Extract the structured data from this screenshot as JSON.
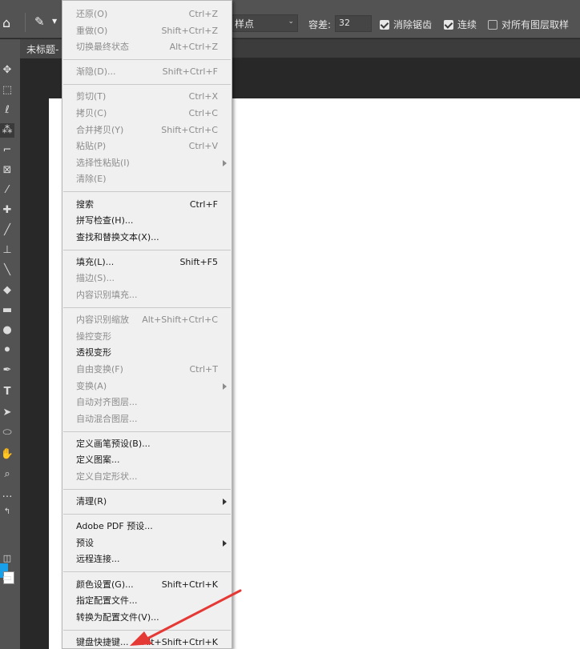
{
  "options_bar": {
    "sample_size": "样点",
    "tolerance_label": "容差:",
    "tolerance_value": "32",
    "antialias_label": "消除锯齿",
    "contiguous_label": "连续",
    "sample_all_label": "对所有图层取样"
  },
  "doc_tab": {
    "label": "未标题-"
  },
  "edit_menu": {
    "groups": [
      [
        {
          "label": "还原(O)",
          "shortcut": "Ctrl+Z",
          "disabled": true
        },
        {
          "label": "重做(O)",
          "shortcut": "Shift+Ctrl+Z",
          "disabled": true
        },
        {
          "label": "切换最终状态",
          "shortcut": "Alt+Ctrl+Z",
          "disabled": true
        }
      ],
      [
        {
          "label": "渐隐(D)...",
          "shortcut": "Shift+Ctrl+F",
          "disabled": true
        }
      ],
      [
        {
          "label": "剪切(T)",
          "shortcut": "Ctrl+X",
          "disabled": true
        },
        {
          "label": "拷贝(C)",
          "shortcut": "Ctrl+C",
          "disabled": true
        },
        {
          "label": "合并拷贝(Y)",
          "shortcut": "Shift+Ctrl+C",
          "disabled": true
        },
        {
          "label": "粘贴(P)",
          "shortcut": "Ctrl+V",
          "disabled": true
        },
        {
          "label": "选择性粘贴(I)",
          "shortcut": "",
          "disabled": true,
          "submenu": true
        },
        {
          "label": "清除(E)",
          "shortcut": "",
          "disabled": true
        }
      ],
      [
        {
          "label": "搜索",
          "shortcut": "Ctrl+F",
          "disabled": false
        },
        {
          "label": "拼写检查(H)...",
          "shortcut": "",
          "disabled": false
        },
        {
          "label": "查找和替换文本(X)...",
          "shortcut": "",
          "disabled": false
        }
      ],
      [
        {
          "label": "填充(L)...",
          "shortcut": "Shift+F5",
          "disabled": false
        },
        {
          "label": "描边(S)...",
          "shortcut": "",
          "disabled": true
        },
        {
          "label": "内容识别填充...",
          "shortcut": "",
          "disabled": true
        }
      ],
      [
        {
          "label": "内容识别缩放",
          "shortcut": "Alt+Shift+Ctrl+C",
          "disabled": true
        },
        {
          "label": "操控变形",
          "shortcut": "",
          "disabled": true
        },
        {
          "label": "透视变形",
          "shortcut": "",
          "disabled": false
        },
        {
          "label": "自由变换(F)",
          "shortcut": "Ctrl+T",
          "disabled": true
        },
        {
          "label": "变换(A)",
          "shortcut": "",
          "disabled": true,
          "submenu": true
        },
        {
          "label": "自动对齐图层...",
          "shortcut": "",
          "disabled": true
        },
        {
          "label": "自动混合图层...",
          "shortcut": "",
          "disabled": true
        }
      ],
      [
        {
          "label": "定义画笔预设(B)...",
          "shortcut": "",
          "disabled": false
        },
        {
          "label": "定义图案...",
          "shortcut": "",
          "disabled": false
        },
        {
          "label": "定义自定形状...",
          "shortcut": "",
          "disabled": true
        }
      ],
      [
        {
          "label": "清理(R)",
          "shortcut": "",
          "disabled": false,
          "submenu": true
        }
      ],
      [
        {
          "label": "Adobe PDF 预设...",
          "shortcut": "",
          "disabled": false
        },
        {
          "label": "预设",
          "shortcut": "",
          "disabled": false,
          "submenu": true
        },
        {
          "label": "远程连接...",
          "shortcut": "",
          "disabled": false
        }
      ],
      [
        {
          "label": "颜色设置(G)...",
          "shortcut": "Shift+Ctrl+K",
          "disabled": false
        },
        {
          "label": "指定配置文件...",
          "shortcut": "",
          "disabled": false
        },
        {
          "label": "转换为配置文件(V)...",
          "shortcut": "",
          "disabled": false
        }
      ],
      [
        {
          "label": "键盘快捷键...",
          "shortcut": "Alt+Shift+Ctrl+K",
          "disabled": false
        }
      ]
    ]
  },
  "colors": {
    "foreground": "#1aa0e8",
    "background": "#ffffff",
    "annotation_arrow": "#e53935"
  }
}
